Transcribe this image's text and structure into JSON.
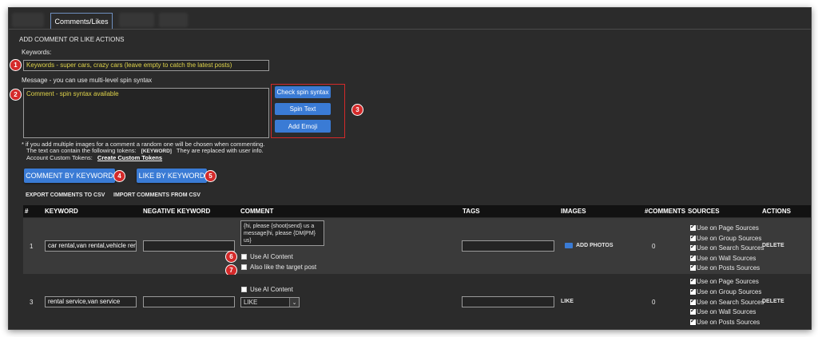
{
  "tabs": {
    "active": "Comments/Likes"
  },
  "section_title": "ADD COMMENT OR LIKE ACTIONS",
  "keywords": {
    "label": "Keywords:",
    "value": "Keywords - super cars, crazy cars  (leave empty to catch the latest posts)"
  },
  "message": {
    "label": "Message - you can use multi-level spin syntax",
    "value": "Comment - spin syntax available"
  },
  "side_buttons": {
    "check": "Check spin syntax",
    "spin": "Spin Text",
    "emoji": "Add Emoji"
  },
  "notes": {
    "line1": "* if you add multiple images for a comment a random one will be chosen when commenting.",
    "line2a": "The text can contain the following tokens:",
    "token": "[KEYWORD]",
    "line2b": "They are replaced with user info.",
    "line3": "Account Custom Tokens:",
    "custom_link": "Create Custom Tokens"
  },
  "actions": {
    "comment_by_keyword": "COMMENT BY KEYWORD",
    "like_by_keyword": "LIKE BY KEYWORD"
  },
  "csv": {
    "export": "EXPORT COMMENTS TO CSV",
    "import": "IMPORT COMMENTS FROM CSV"
  },
  "badges": [
    "1",
    "2",
    "3",
    "4",
    "5",
    "6",
    "7"
  ],
  "table": {
    "headers": [
      "#",
      "KEYWORD",
      "NEGATIVE KEYWORD",
      "COMMENT",
      "TAGS",
      "IMAGES",
      "#COMMENTS",
      "SOURCES",
      "ACTIONS"
    ],
    "rows": [
      {
        "num": "1",
        "keyword": "car rental,van rental,vehicle rental",
        "negative": "",
        "comment": "{hi, please {shoot|send} us a message|hi, please {DM|PM} us}",
        "use_ai_label": "Use AI Content",
        "use_ai_checked": false,
        "also_like_label": "Also like the target post",
        "also_like_checked": false,
        "tags": "",
        "images": "ADD PHOTOS",
        "comments_count": "0",
        "sources": [
          "Use on Page Sources",
          "Use on Group Sources",
          "Use on Search Sources",
          "Use on Wall Sources",
          "Use on Posts Sources"
        ],
        "action": "DELETE"
      },
      {
        "num": "3",
        "keyword": "rental service,van service",
        "negative": "",
        "use_ai_label": "Use AI Content",
        "use_ai_checked": false,
        "select_value": "LIKE",
        "tags": "",
        "images": "LIKE",
        "comments_count": "0",
        "sources": [
          "Use on Page Sources",
          "Use on Group Sources",
          "Use on Search Sources",
          "Use on Wall Sources",
          "Use on Posts Sources"
        ],
        "action": "DELETE"
      }
    ]
  },
  "colors": {
    "accent": "#3a7bd5",
    "badge": "#d42a2a",
    "highlight_text": "#e0d44a",
    "background": "#2b2b2b"
  }
}
